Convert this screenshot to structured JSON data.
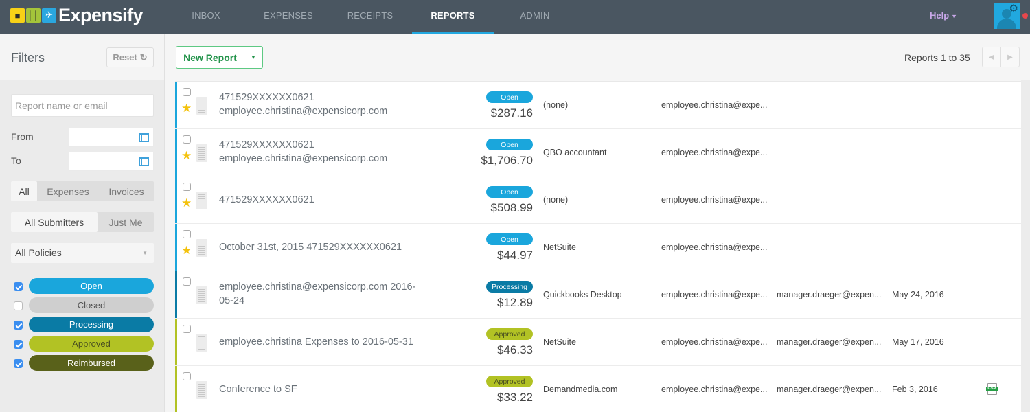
{
  "app": {
    "brand": "Expensify",
    "logo_tiles": [
      "taxi-icon",
      "food-icon",
      "plane-icon"
    ]
  },
  "nav": {
    "items": [
      {
        "label": "INBOX",
        "active": false
      },
      {
        "label": "EXPENSES",
        "active": false
      },
      {
        "label": "RECEIPTS",
        "active": false
      },
      {
        "label": "REPORTS",
        "active": true
      },
      {
        "label": "ADMIN",
        "active": false
      }
    ],
    "help_label": "Help",
    "accent_color": "#22a8e0"
  },
  "sidebar": {
    "title": "Filters",
    "reset_label": "Reset",
    "search_placeholder": "Report name or email",
    "search_value": "",
    "from_label": "From",
    "to_label": "To",
    "from_value": "",
    "to_value": "",
    "type_segments": [
      {
        "label": "All",
        "selected": true
      },
      {
        "label": "Expenses",
        "selected": false
      },
      {
        "label": "Invoices",
        "selected": false
      }
    ],
    "submitter_segments": [
      {
        "label": "All Submitters",
        "selected": true
      },
      {
        "label": "Just Me",
        "selected": false
      }
    ],
    "policy_select": "All Policies",
    "statuses": [
      {
        "label": "Open",
        "checked": true,
        "bg": "#1aa6dc",
        "fg": "#ffffff"
      },
      {
        "label": "Closed",
        "checked": false,
        "bg": "#cfcfcf",
        "fg": "#555555"
      },
      {
        "label": "Processing",
        "checked": true,
        "bg": "#0a7ba5",
        "fg": "#ffffff"
      },
      {
        "label": "Approved",
        "checked": true,
        "bg": "#b2c224",
        "fg": "#4a5020"
      },
      {
        "label": "Reimbursed",
        "checked": true,
        "bg": "#59611a",
        "fg": "#ffffff"
      }
    ]
  },
  "main": {
    "new_report_label": "New Report",
    "page_count": "Reports 1 to 35",
    "reports": [
      {
        "title": "471529XXXXXX0621\nemployee.christina@expensicorp.com",
        "starred": true,
        "status": "Open",
        "amount": "$287.16",
        "policy": "(none)",
        "submitter": "employee.christina@expe...",
        "approver": "",
        "date": "",
        "csv": false
      },
      {
        "title": "471529XXXXXX0621\nemployee.christina@expensicorp.com",
        "starred": true,
        "status": "Open",
        "amount": "$1,706.70",
        "policy": "QBO accountant",
        "submitter": "employee.christina@expe...",
        "approver": "",
        "date": "",
        "csv": false
      },
      {
        "title": "471529XXXXXX0621",
        "starred": true,
        "status": "Open",
        "amount": "$508.99",
        "policy": "(none)",
        "submitter": "employee.christina@expe...",
        "approver": "",
        "date": "",
        "csv": false
      },
      {
        "title": "October 31st, 2015 471529XXXXXX0621",
        "starred": true,
        "status": "Open",
        "amount": "$44.97",
        "policy": "NetSuite",
        "submitter": "employee.christina@expe...",
        "approver": "",
        "date": "",
        "csv": false
      },
      {
        "title": "employee.christina@expensicorp.com 2016-\n05-24",
        "starred": false,
        "status": "Processing",
        "amount": "$12.89",
        "policy": "Quickbooks Desktop",
        "submitter": "employee.christina@expe...",
        "approver": "manager.draeger@expen...",
        "date": "May 24, 2016",
        "csv": false
      },
      {
        "title": "employee.christina Expenses to 2016-05-31",
        "starred": false,
        "status": "Approved",
        "amount": "$46.33",
        "policy": "NetSuite",
        "submitter": "employee.christina@expe...",
        "approver": "manager.draeger@expen...",
        "date": "May 17, 2016",
        "csv": false
      },
      {
        "title": "Conference to SF",
        "starred": false,
        "status": "Approved",
        "amount": "$33.22",
        "policy": "Demandmedia.com",
        "submitter": "employee.christina@expe...",
        "approver": "manager.draeger@expen...",
        "date": "Feb 3, 2016",
        "csv": true
      }
    ],
    "csv_label": "CSV"
  }
}
